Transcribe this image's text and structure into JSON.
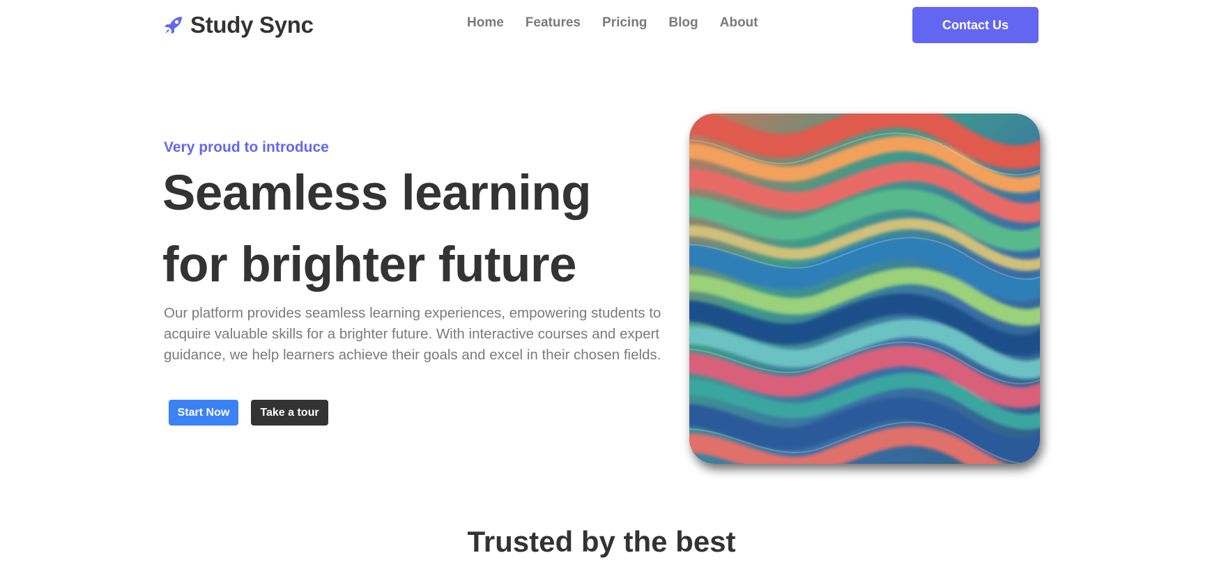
{
  "header": {
    "brand_icon": "rocket-icon",
    "brand_name": "Study Sync",
    "nav": [
      "Home",
      "Features",
      "Pricing",
      "Blog",
      "About"
    ],
    "contact_label": "Contact Us"
  },
  "hero": {
    "tagline": "Very proud to introduce",
    "title_line1": "Seamless learning",
    "title_line2": "for brighter future",
    "description": "Our platform provides seamless learning experiences, empowering students to acquire valuable skills for a brighter future. With interactive courses and expert guidance, we help learners achieve their goals and excel in their chosen fields.",
    "primary_button": "Start Now",
    "secondary_button": "Take a tour"
  },
  "trusted": {
    "title": "Trusted by the best"
  },
  "colors": {
    "accent": "#6366f1",
    "primary_button": "#3b82f6",
    "dark_button": "#333333",
    "heading": "#333333",
    "muted": "#7a7a7a"
  }
}
